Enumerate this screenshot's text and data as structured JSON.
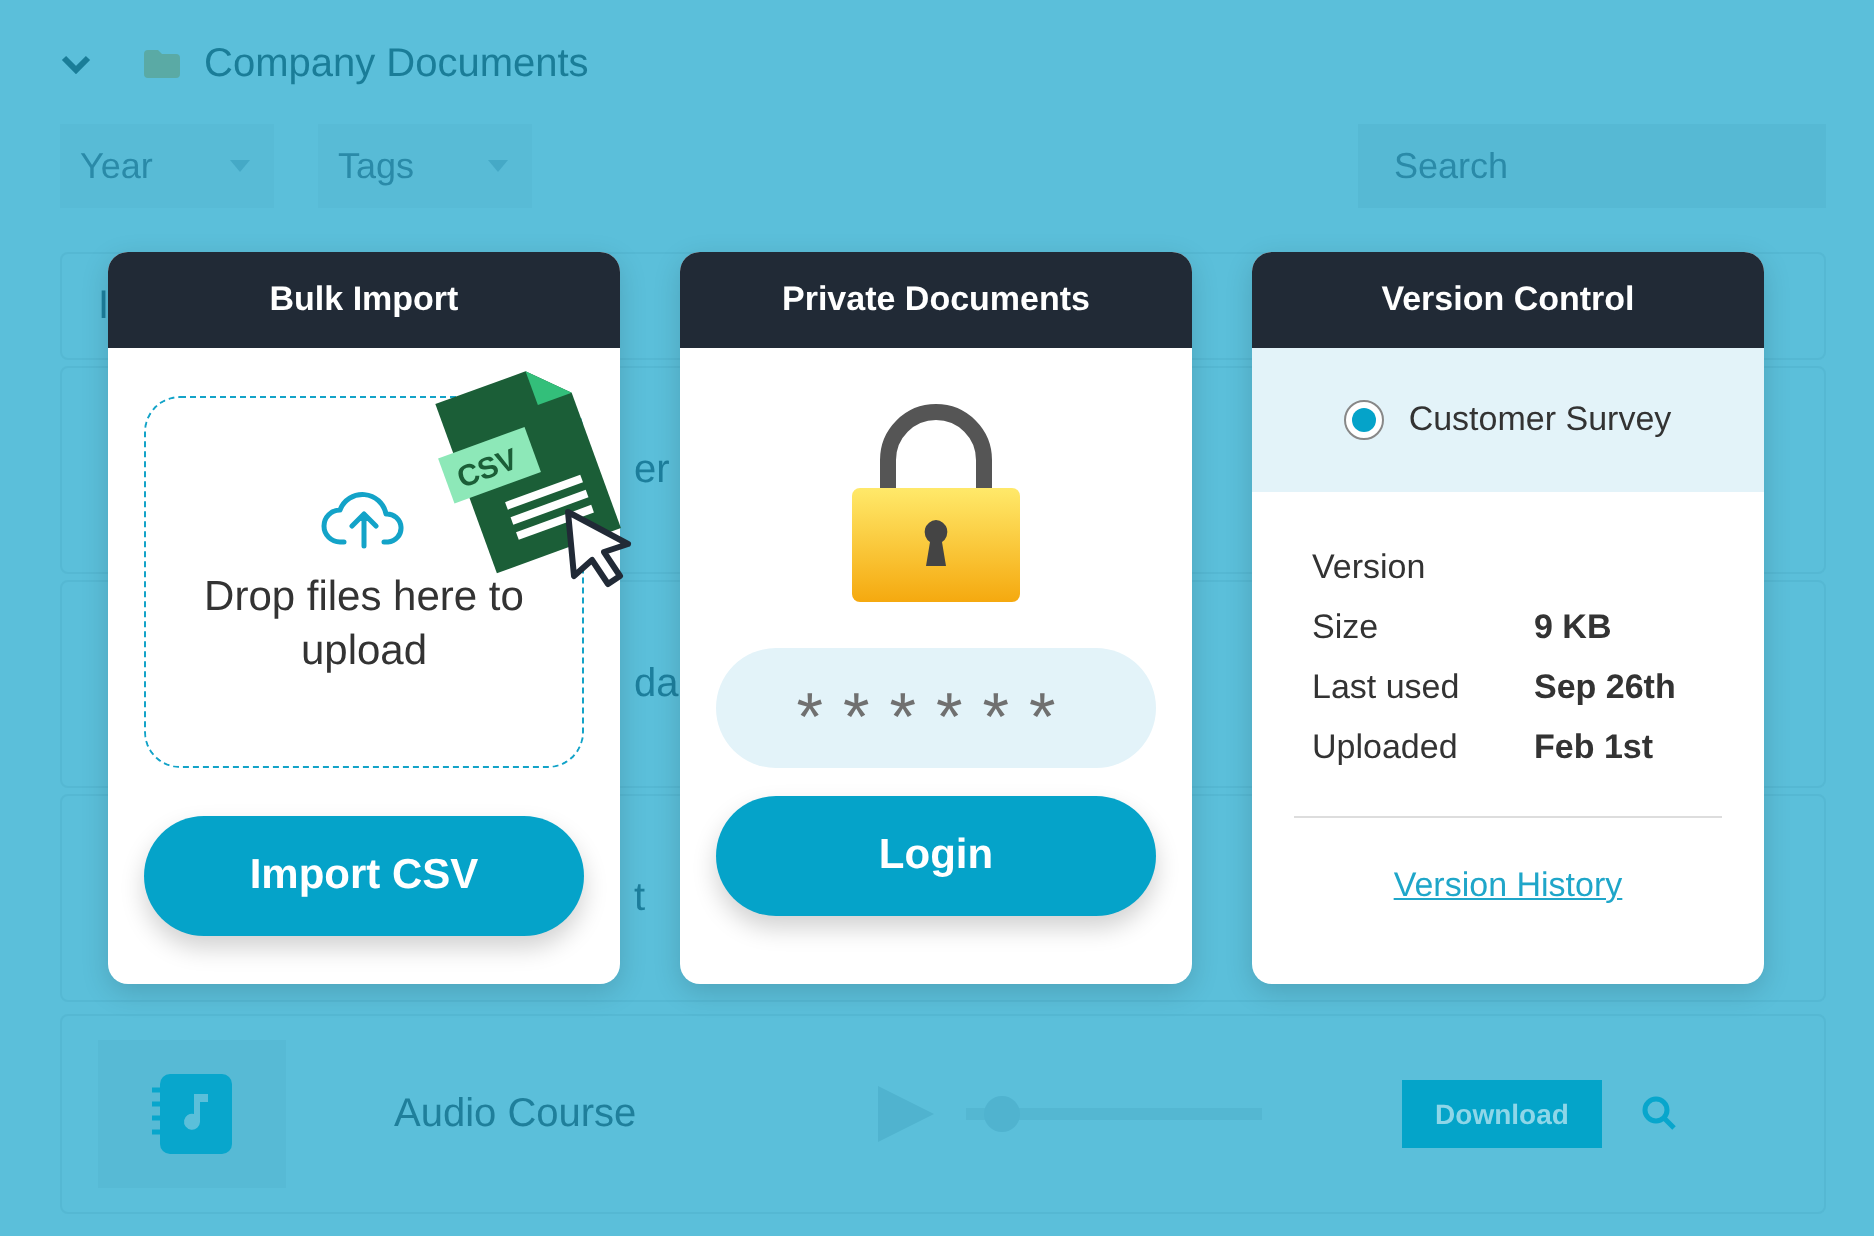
{
  "folder": {
    "title": "Company Documents",
    "expanded": true
  },
  "filters": [
    {
      "label": "Year"
    },
    {
      "label": "Tags"
    }
  ],
  "search": {
    "placeholder": "Search"
  },
  "list_header": {
    "column_1": "I"
  },
  "rows": [
    {
      "label": "er"
    },
    {
      "label": "da"
    },
    {
      "label": "t"
    }
  ],
  "audio_row": {
    "title": "Audio Course",
    "level": 0.12,
    "download": "Download"
  },
  "cards": [
    {
      "kind": "import",
      "title": "Bulk Import",
      "badge": "CSV",
      "drop_text": "Drop files here to upload",
      "button": "Import CSV"
    },
    {
      "kind": "private",
      "title": "Private Documents",
      "password": "******",
      "button": "Login"
    },
    {
      "kind": "version",
      "title": "Version Control",
      "file": {
        "label": "Customer Survey",
        "selected": true
      },
      "details": [
        {
          "label": "Version"
        },
        {
          "label": "Size",
          "value": "9 KB"
        },
        {
          "label": "Last used",
          "value": "Sep 26th"
        },
        {
          "label": "Uploaded",
          "value": "Feb 1st"
        }
      ],
      "link": "Version History"
    }
  ]
}
